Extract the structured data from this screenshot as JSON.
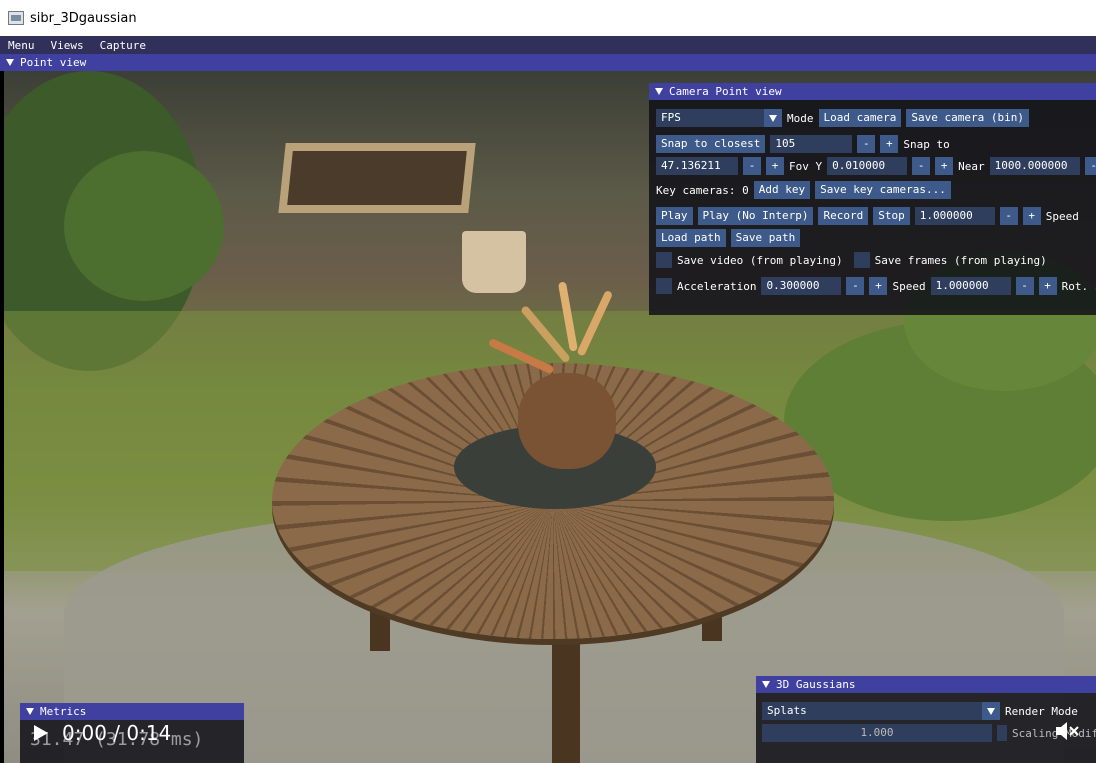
{
  "window": {
    "title": "sibr_3Dgaussian"
  },
  "menubar": {
    "items": [
      "Menu",
      "Views",
      "Capture"
    ]
  },
  "point_view": {
    "title": "Point view"
  },
  "camera_panel": {
    "title": "Camera Point view",
    "mode_value": "FPS",
    "mode_label": "Mode",
    "load_camera": "Load camera",
    "save_camera": "Save camera (bin)",
    "snap_to_closest": "Snap to closest",
    "snap_value": "105",
    "snap_to_label": "Snap to",
    "fov_value": "47.136211",
    "fov_label": "Fov Y",
    "near_value": "0.010000",
    "near_label": "Near",
    "far_value": "1000.000000",
    "key_cameras_label": "Key cameras: 0",
    "add_key": "Add key",
    "save_key_cameras": "Save key cameras...",
    "play": "Play",
    "play_no_interp": "Play (No Interp)",
    "record": "Record",
    "stop": "Stop",
    "speed_value": "1.000000",
    "speed_label": "Speed",
    "load_path": "Load path",
    "save_path": "Save path",
    "save_video": "Save video (from playing)",
    "save_frames": "Save frames (from playing)",
    "acceleration_label": "Acceleration",
    "acceleration_value": "0.300000",
    "speed2_label": "Speed",
    "speed2_value": "1.000000",
    "rot_label": "Rot. s"
  },
  "gaussians_panel": {
    "title": "3D Gaussians",
    "render_value": "Splats",
    "render_label": "Render Mode",
    "scaling_value": "1.000",
    "scaling_label": "Scaling Modifi"
  },
  "metrics_panel": {
    "title": "Metrics",
    "fps_text": "31.47 (31.78 ms)"
  },
  "video": {
    "time": "0:00 / 0:14"
  },
  "colors": {
    "title_bar_bg": "#3f40a0",
    "button_bg": "#3d5a8a",
    "field_bg": "#2e3e5c",
    "panel_bg": "#121218"
  }
}
